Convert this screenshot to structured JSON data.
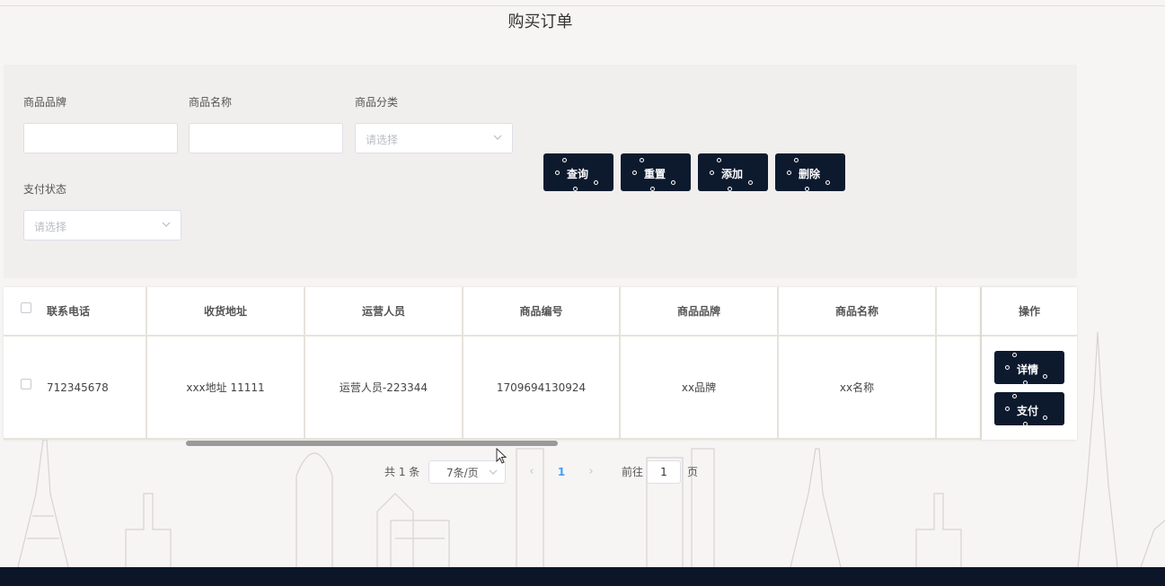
{
  "page": {
    "title": "购买订单"
  },
  "filters": {
    "brand_label": "商品品牌",
    "name_label": "商品名称",
    "category_label": "商品分类",
    "category_placeholder": "请选择",
    "pay_status_label": "支付状态",
    "pay_status_placeholder": "请选择"
  },
  "actions": {
    "query": "查询",
    "reset": "重置",
    "add": "添加",
    "delete": "删除"
  },
  "table": {
    "headers": [
      "联系电话",
      "收货地址",
      "运营人员",
      "商品编号",
      "商品品牌",
      "商品名称",
      "操作"
    ],
    "rows": [
      {
        "phone": "712345678",
        "address": "xxx地址 11111",
        "operator": "运营人员-223344",
        "product_no": "1709694130924",
        "brand": "xx品牌",
        "name": "xx名称"
      }
    ],
    "row_actions": {
      "detail": "详情",
      "pay": "支付"
    }
  },
  "pagination": {
    "total_text": "共 1 条",
    "page_size": "7条/页",
    "current_page": "1",
    "goto_label": "前往",
    "goto_value": "1",
    "page_suffix": "页"
  },
  "colors": {
    "dark_button": "#0d1a2e",
    "footer": "#0c1628",
    "accent": "#409eff"
  }
}
